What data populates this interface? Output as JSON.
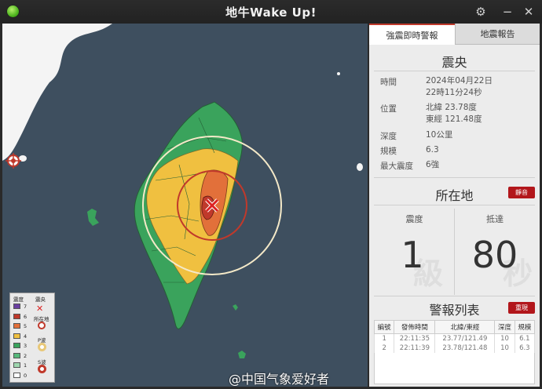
{
  "window": {
    "title": "地牛Wake Up!"
  },
  "tabs": [
    {
      "label": "強震即時警報"
    },
    {
      "label": "地震報告"
    }
  ],
  "epicenter": {
    "heading": "震央",
    "time_label": "時間",
    "date": "2024年04月22日",
    "time": "22時11分24秒",
    "location_label": "位置",
    "lat": "北緯 23.78度",
    "lon": "東經 121.48度",
    "depth_label": "深度",
    "depth": "10公里",
    "magnitude_label": "規模",
    "magnitude": "6.3",
    "max_intensity_label": "最大震度",
    "max_intensity": "6強"
  },
  "location": {
    "heading": "所在地",
    "button": "靜音",
    "intensity_label": "震度",
    "intensity": "1",
    "intensity_unit": "級",
    "arrival_label": "抵達",
    "arrival": "80",
    "arrival_unit": "秒"
  },
  "alerts": {
    "heading": "警報列表",
    "button": "重現",
    "columns": [
      "編號",
      "發佈時間",
      "北緯/東經",
      "深度",
      "規模"
    ],
    "rows": [
      [
        "1",
        "22:11:35",
        "23.77/121.49",
        "10",
        "6.1"
      ],
      [
        "2",
        "22:11:39",
        "23.78/121.48",
        "10",
        "6.3"
      ]
    ]
  },
  "legend": {
    "title": "震度",
    "levels": [
      {
        "label": "7",
        "color": "#6a3ea1"
      },
      {
        "label": "6",
        "color": "#c0392b"
      },
      {
        "label": "5",
        "color": "#e2703a"
      },
      {
        "label": "4",
        "color": "#f0c040"
      },
      {
        "label": "3",
        "color": "#3aa35c"
      },
      {
        "label": "2",
        "color": "#56b87a"
      },
      {
        "label": "1",
        "color": "#9ed6ae"
      },
      {
        "label": "0",
        "color": "#ffffff"
      }
    ],
    "epicenter_label": "震央",
    "location_label": "所在地",
    "p_wave_label": "P波",
    "s_wave_label": "S波"
  },
  "watermark": "@中国气象爱好者",
  "colors": {
    "accent": "#b2161b",
    "sea": "#3e4f5f",
    "land_mainland": "#f4f4f4"
  }
}
